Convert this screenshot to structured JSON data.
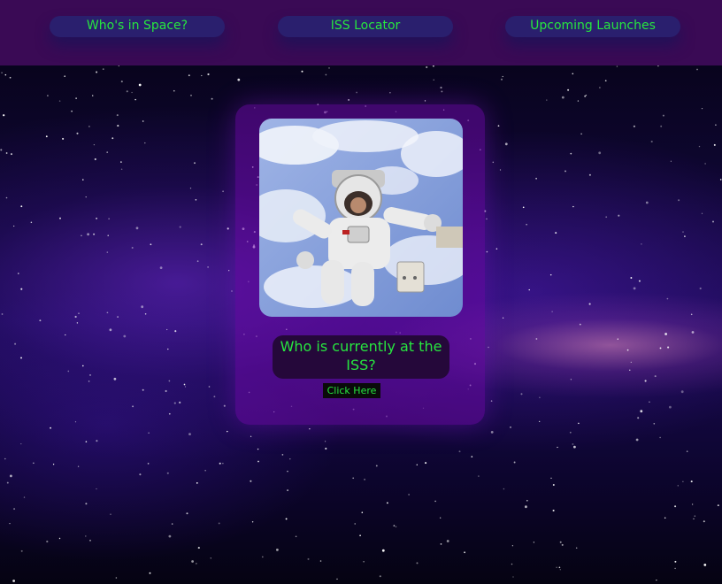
{
  "nav": {
    "items": [
      {
        "label": "Who's in Space?"
      },
      {
        "label": "ISS Locator"
      },
      {
        "label": "Upcoming Launches"
      }
    ]
  },
  "card": {
    "question": "Who is currently at the ISS?",
    "button_label": "Click Here"
  },
  "colors": {
    "accent_text": "#27e63f",
    "navbar": "#3a0a55",
    "nav_button": "#2a1f6e",
    "card": "#6e0aaa",
    "question_box": "#25083a"
  }
}
